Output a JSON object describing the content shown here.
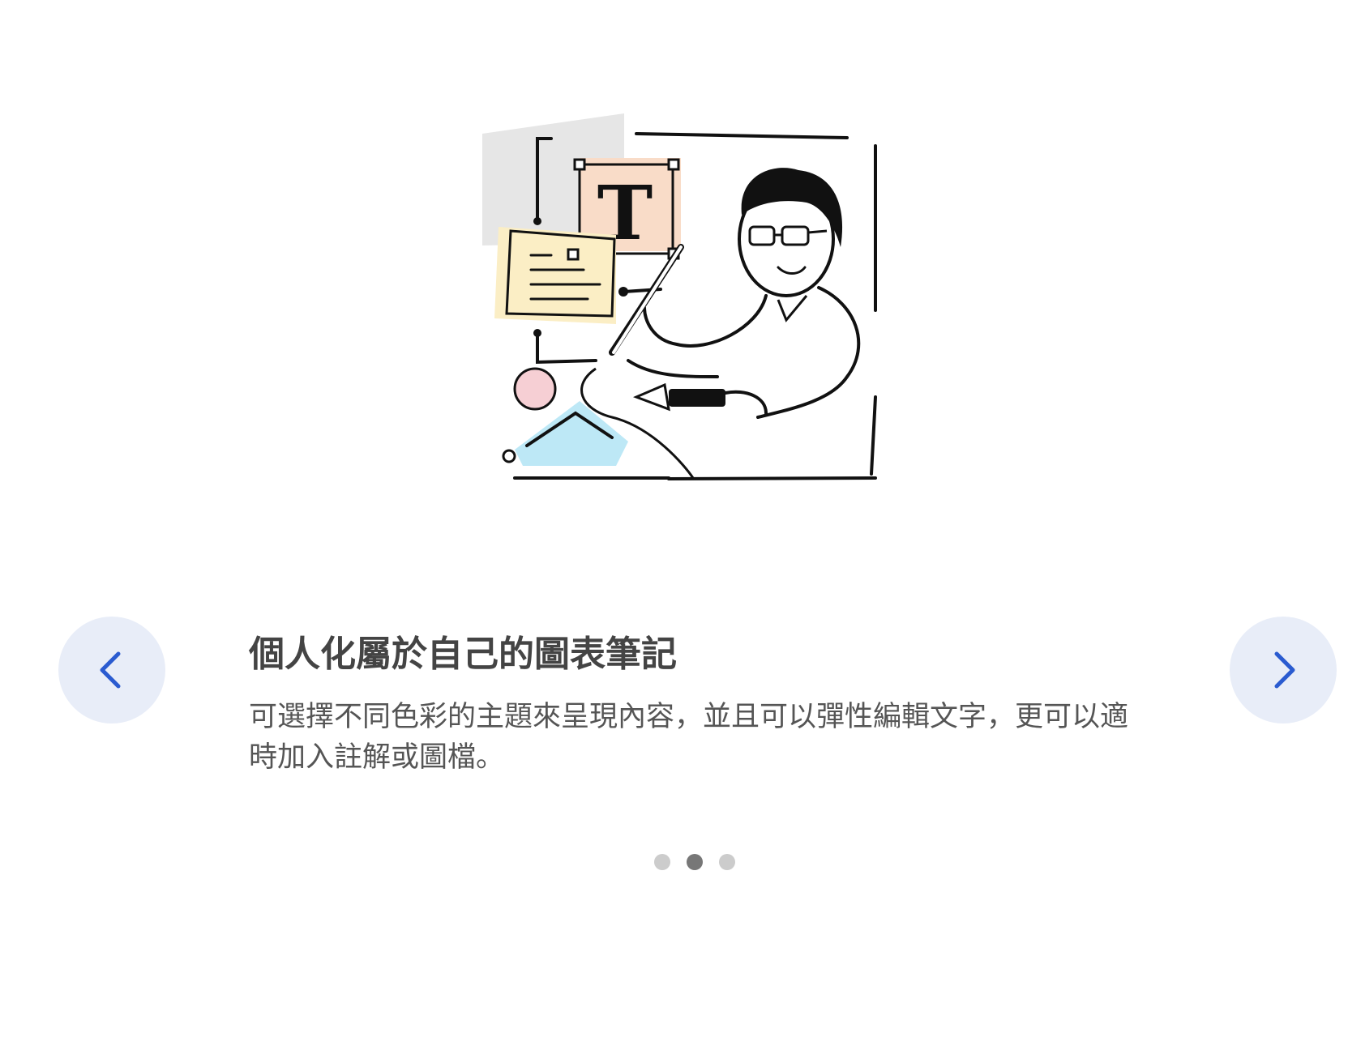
{
  "slide": {
    "title": "個人化屬於自己的圖表筆記",
    "description": "可選擇不同色彩的主題來呈現內容，並且可以彈性編輯文字，更可以適時加入註解或圖檔。",
    "illustration_icon": "person-with-pen-editing-document-illustration"
  },
  "pagination": {
    "total": 3,
    "active_index": 1
  },
  "colors": {
    "nav_button_bg": "#e8edf8",
    "nav_arrow": "#2a5bd0",
    "title_text": "#444444",
    "body_text": "#555555",
    "dot_inactive": "#cccccc",
    "dot_active": "#777777"
  },
  "icons": {
    "prev": "chevron-left-icon",
    "next": "chevron-right-icon"
  }
}
